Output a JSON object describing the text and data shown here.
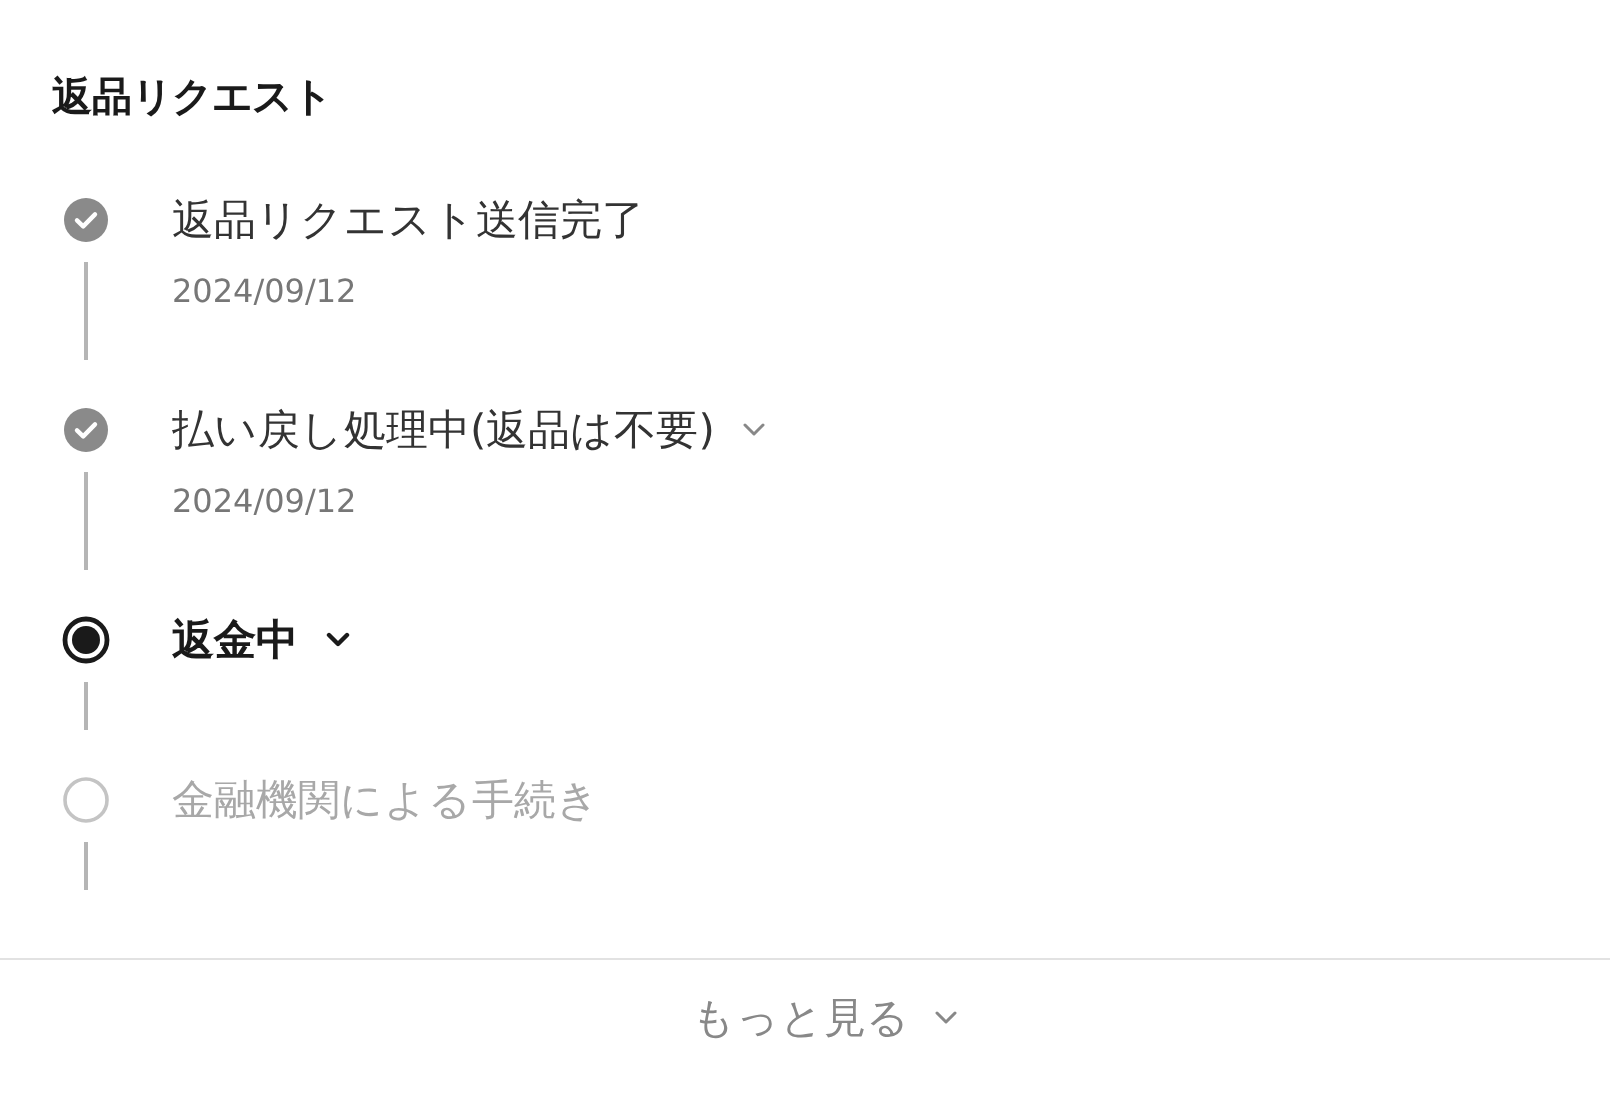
{
  "section": {
    "title": "返品リクエスト"
  },
  "steps": [
    {
      "kind": "done",
      "label": "返品リクエスト送信完了",
      "date": "2024/09/12",
      "expandable": false
    },
    {
      "kind": "done",
      "label": "払い戻し処理中(返品は不要)",
      "date": "2024/09/12",
      "expandable": true
    },
    {
      "kind": "current",
      "label": "返金中",
      "expandable": true
    },
    {
      "kind": "pending",
      "label": "金融機関による手続き",
      "expandable": false
    }
  ],
  "more_link": {
    "label": "もっと見る",
    "expandable": true
  }
}
